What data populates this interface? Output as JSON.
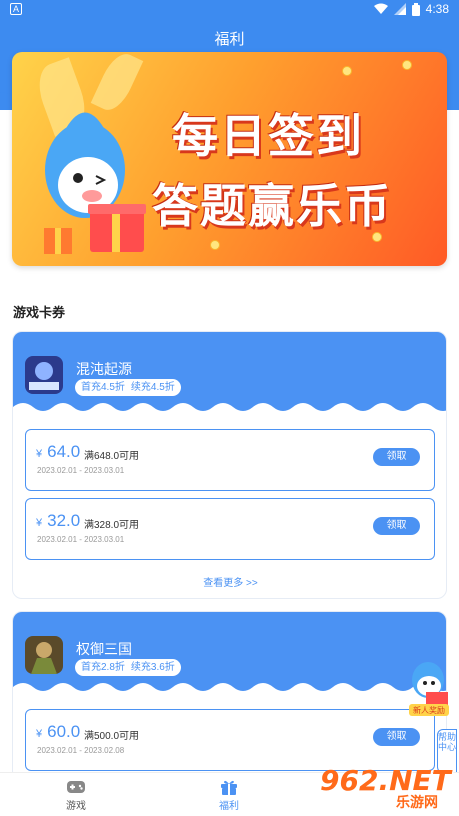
{
  "status_bar": {
    "time": "4:38",
    "app_badge": "A"
  },
  "header": {
    "title": "福利"
  },
  "banner": {
    "line1": "每日签到",
    "line2": "答题赢乐币"
  },
  "section": {
    "title": "游戏卡券"
  },
  "games": [
    {
      "name": "混沌起源",
      "first_recharge": "首充4.5折",
      "renew_recharge": "续充4.5折",
      "coupons": [
        {
          "amount": "64.0",
          "currency": "¥",
          "condition": "满648.0可用",
          "date_range": "2023.02.01 - 2023.03.01",
          "claim_label": "领取"
        },
        {
          "amount": "32.0",
          "currency": "¥",
          "condition": "满328.0可用",
          "date_range": "2023.02.01 - 2023.03.01",
          "claim_label": "领取"
        }
      ],
      "more_label": "查看更多 >>"
    },
    {
      "name": "权御三国",
      "first_recharge": "首充2.8折",
      "renew_recharge": "续充3.6折",
      "coupons": [
        {
          "amount": "60.0",
          "currency": "¥",
          "condition": "满500.0可用",
          "date_range": "2023.02.01 - 2023.02.08",
          "claim_label": "领取"
        }
      ]
    }
  ],
  "floating": {
    "new_user_reward": "新人奖励",
    "help": "帮助中心"
  },
  "tabbar": {
    "games": "游戏",
    "welfare": "福利"
  },
  "watermark": {
    "brand": "962.NET",
    "sub": "乐游网"
  },
  "colors": {
    "primary": "#4b92f3",
    "header": "#3d8bf0",
    "banner_orange": "#ff5a26"
  }
}
